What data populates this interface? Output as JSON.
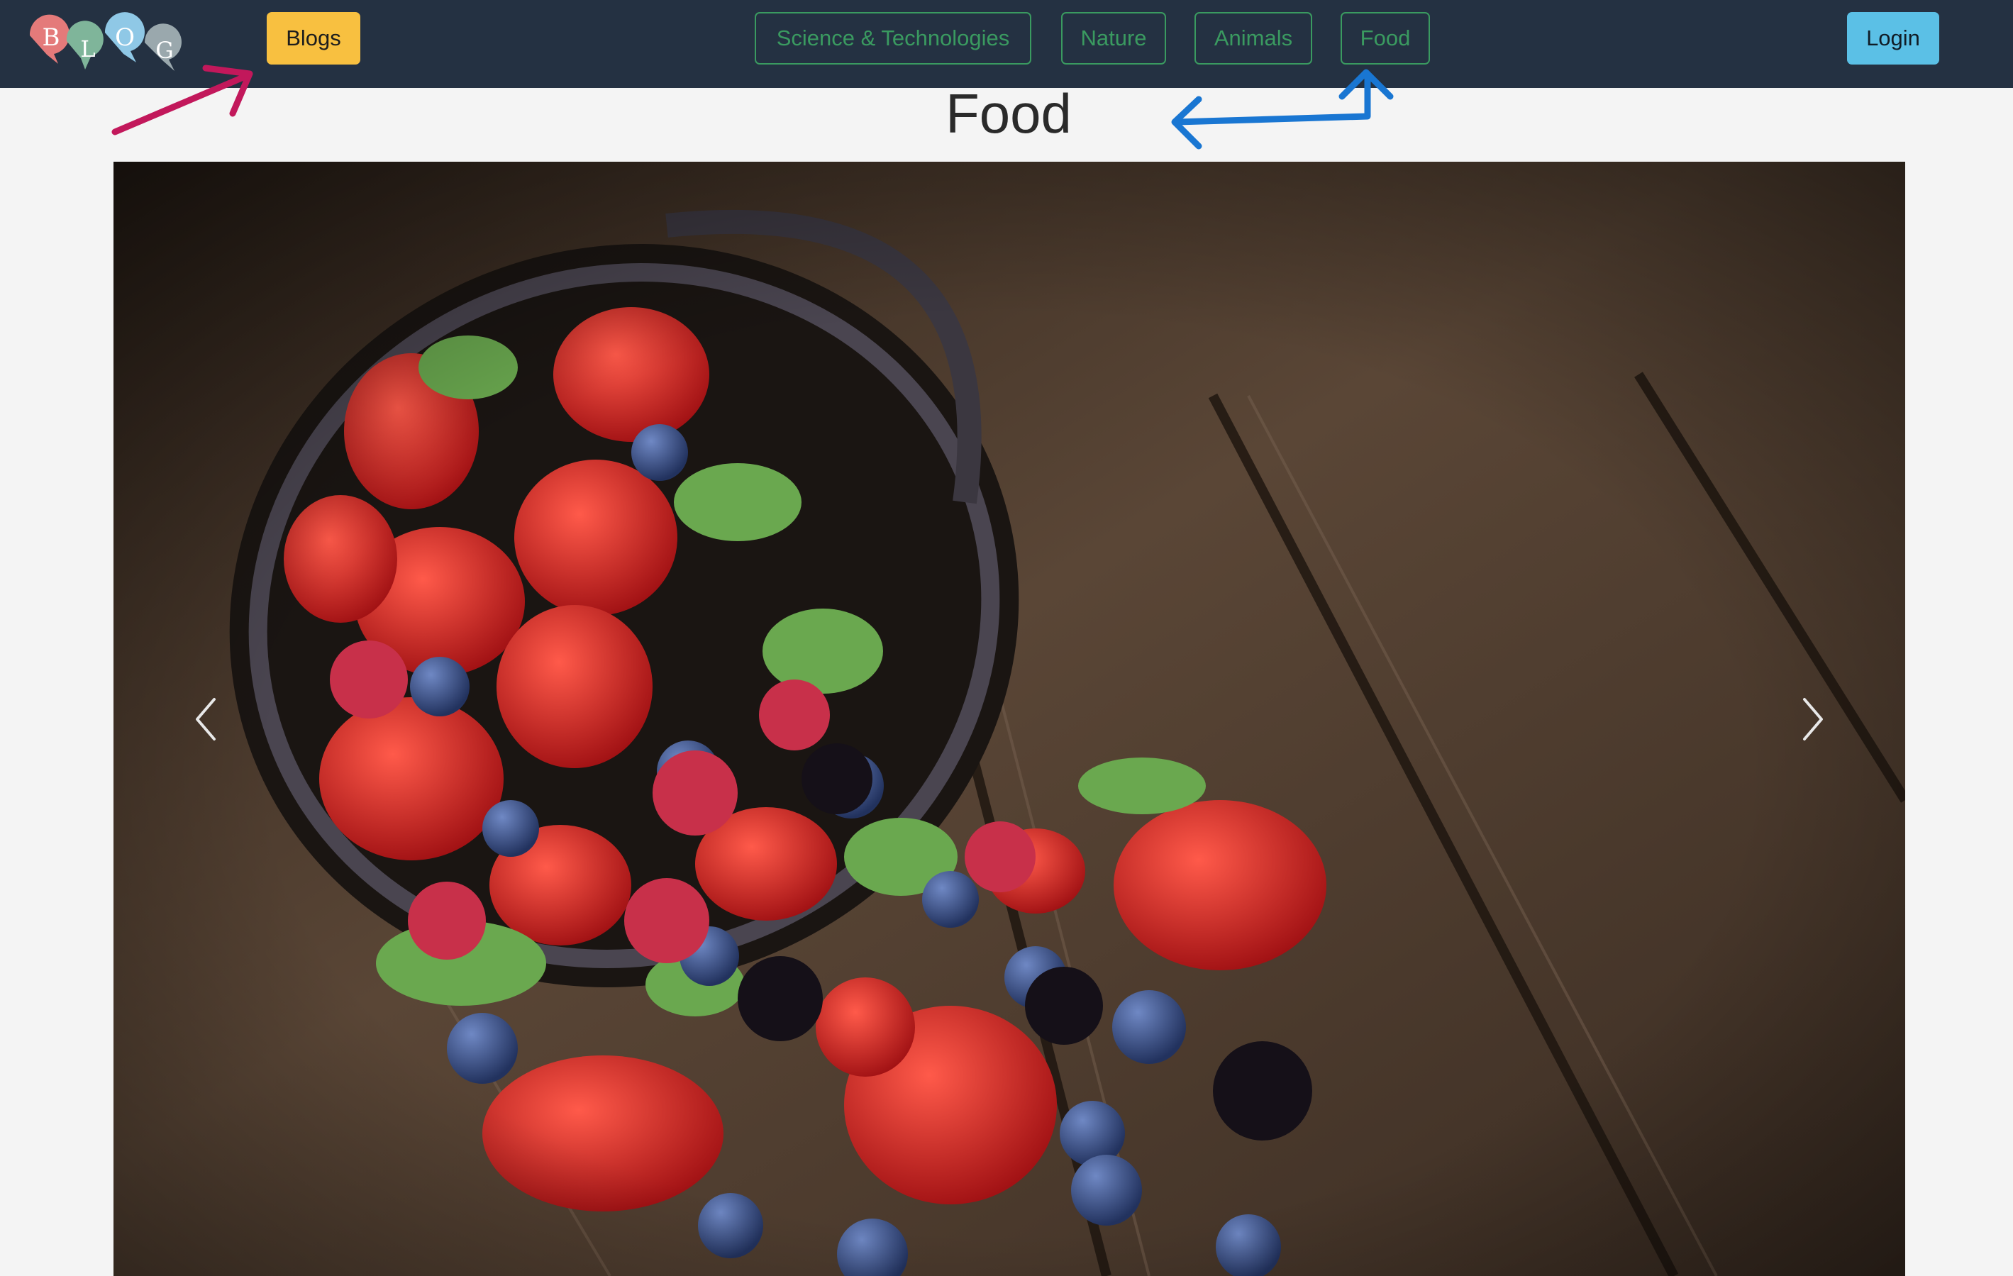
{
  "navbar": {
    "logo_letters": [
      "B",
      "L",
      "O",
      "G"
    ],
    "blogs_label": "Blogs",
    "categories": [
      "Science & Technologies",
      "Nature",
      "Animals",
      "Food"
    ],
    "login_label": "Login"
  },
  "page": {
    "title": "Food"
  },
  "carousel": {
    "prev_icon": "chevron-left-icon",
    "next_icon": "chevron-right-icon"
  },
  "colors": {
    "navbar_bg": "#243142",
    "blogs_button": "#f8c040",
    "category_outline": "#3a9a60",
    "login_button": "#5bc0e6",
    "annotation_arrow_magenta": "#c2185b",
    "annotation_arrow_blue": "#1976d2"
  }
}
